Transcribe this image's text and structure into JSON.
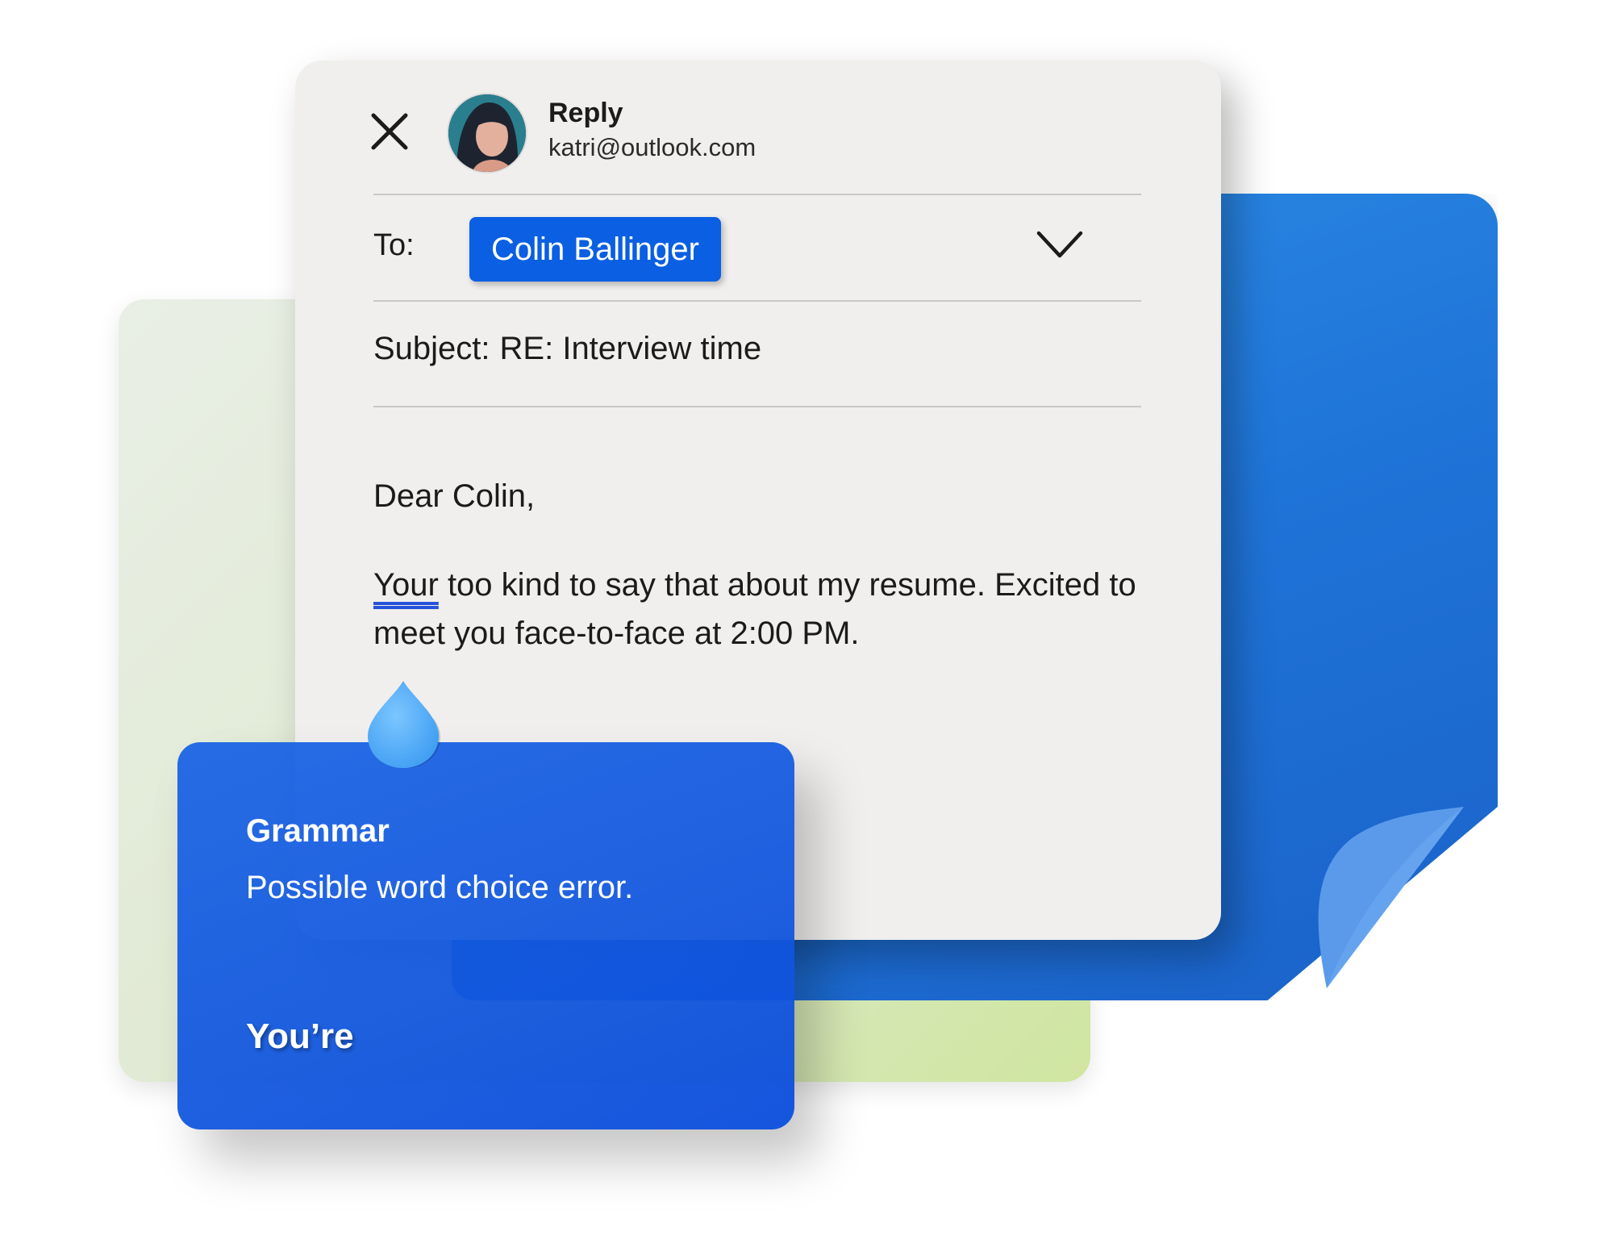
{
  "reply": {
    "title": "Reply",
    "from_email": "katri@outlook.com"
  },
  "compose": {
    "to_label": "To:",
    "recipient": "Colin Ballinger",
    "subject_label": "Subject:",
    "subject_value": "RE: Interview time",
    "greeting": "Dear Colin,",
    "body_flagged_word": "Your",
    "body_rest": " too kind to say that about my resume. Excited to meet you face-to-face at 2:00 PM."
  },
  "grammar": {
    "title": "Grammar",
    "description": "Possible word choice error.",
    "suggestion": "You’re"
  },
  "icons": {
    "close": "close-icon",
    "avatar": "avatar",
    "chevron": "chevron-down-icon",
    "pin": "pin-drop-icon"
  },
  "colors": {
    "accent_blue": "#0a5fe2",
    "grammar_card": "#1559dd",
    "sheet_blue": "#2080dc",
    "sheet_green": "#dfe9d0",
    "email_bg": "#f0efee"
  }
}
